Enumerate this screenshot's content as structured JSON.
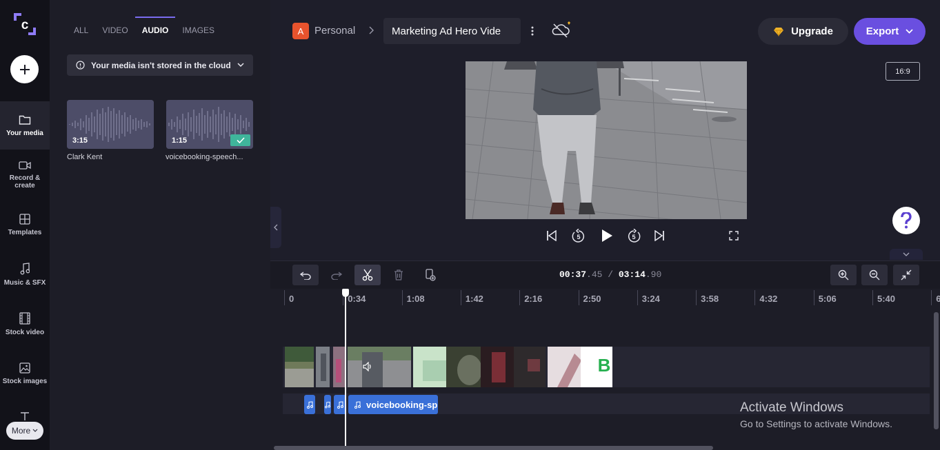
{
  "rail": {
    "items": [
      {
        "label": "Your media"
      },
      {
        "label": "Record & create"
      },
      {
        "label": "Templates"
      },
      {
        "label": "Music & SFX"
      },
      {
        "label": "Stock video"
      },
      {
        "label": "Stock images"
      }
    ],
    "more_label": "More"
  },
  "media_panel": {
    "tabs": [
      "ALL",
      "VIDEO",
      "AUDIO",
      "IMAGES"
    ],
    "active_tab": "AUDIO",
    "cloud_notice": "Your media isn't stored in the cloud",
    "items": [
      {
        "name": "Clark Kent",
        "duration": "3:15",
        "added": false
      },
      {
        "name": "voicebooking-speech...",
        "duration": "1:15",
        "added": true
      }
    ]
  },
  "header": {
    "workspace_initial": "A",
    "workspace_label": "Personal",
    "project_title": "Marketing Ad Hero Vide",
    "upgrade_label": "Upgrade",
    "export_label": "Export",
    "aspect_ratio": "16:9"
  },
  "playback": {
    "current_time": "00:37",
    "current_frac": ".45",
    "separator": "/",
    "total_time": "03:14",
    "total_frac": ".90",
    "skip_seconds": "5"
  },
  "timeline": {
    "ruler_labels": [
      "0",
      "0:34",
      "1:08",
      "1:42",
      "2:16",
      "2:50",
      "3:24",
      "3:58",
      "4:32",
      "5:06",
      "5:40",
      "6"
    ],
    "audio_clip_label": "voicebooking-sp",
    "video_clip_letter": "B"
  },
  "overlay": {
    "activate_title": "Activate Windows",
    "activate_sub": "Go to Settings to activate Windows."
  },
  "colors": {
    "accent": "#6a4fe0",
    "tab_underline": "#7a6cf0",
    "check_green": "#3fb59b",
    "audio_clip": "#3a70d8",
    "workspace_icon": "#e8532d",
    "premium_gold": "#f0b429"
  },
  "icons": [
    "clipchamp-logo-icon",
    "plus-icon",
    "folder-icon",
    "camera-icon",
    "templates-icon",
    "music-note-icon",
    "film-icon",
    "image-icon",
    "text-icon",
    "chevron-down-icon",
    "info-icon",
    "check-icon",
    "chevron-right-icon",
    "kebab-menu-icon",
    "cloud-off-icon",
    "diamond-icon",
    "skip-back-icon",
    "rewind-5-icon",
    "play-icon",
    "forward-5-icon",
    "skip-forward-icon",
    "fullscreen-icon",
    "help-icon",
    "undo-icon",
    "redo-icon",
    "scissors-icon",
    "trash-icon",
    "duplicate-icon",
    "zoom-in-icon",
    "zoom-out-icon",
    "fit-icon",
    "collapse-left-icon",
    "speaker-icon"
  ]
}
